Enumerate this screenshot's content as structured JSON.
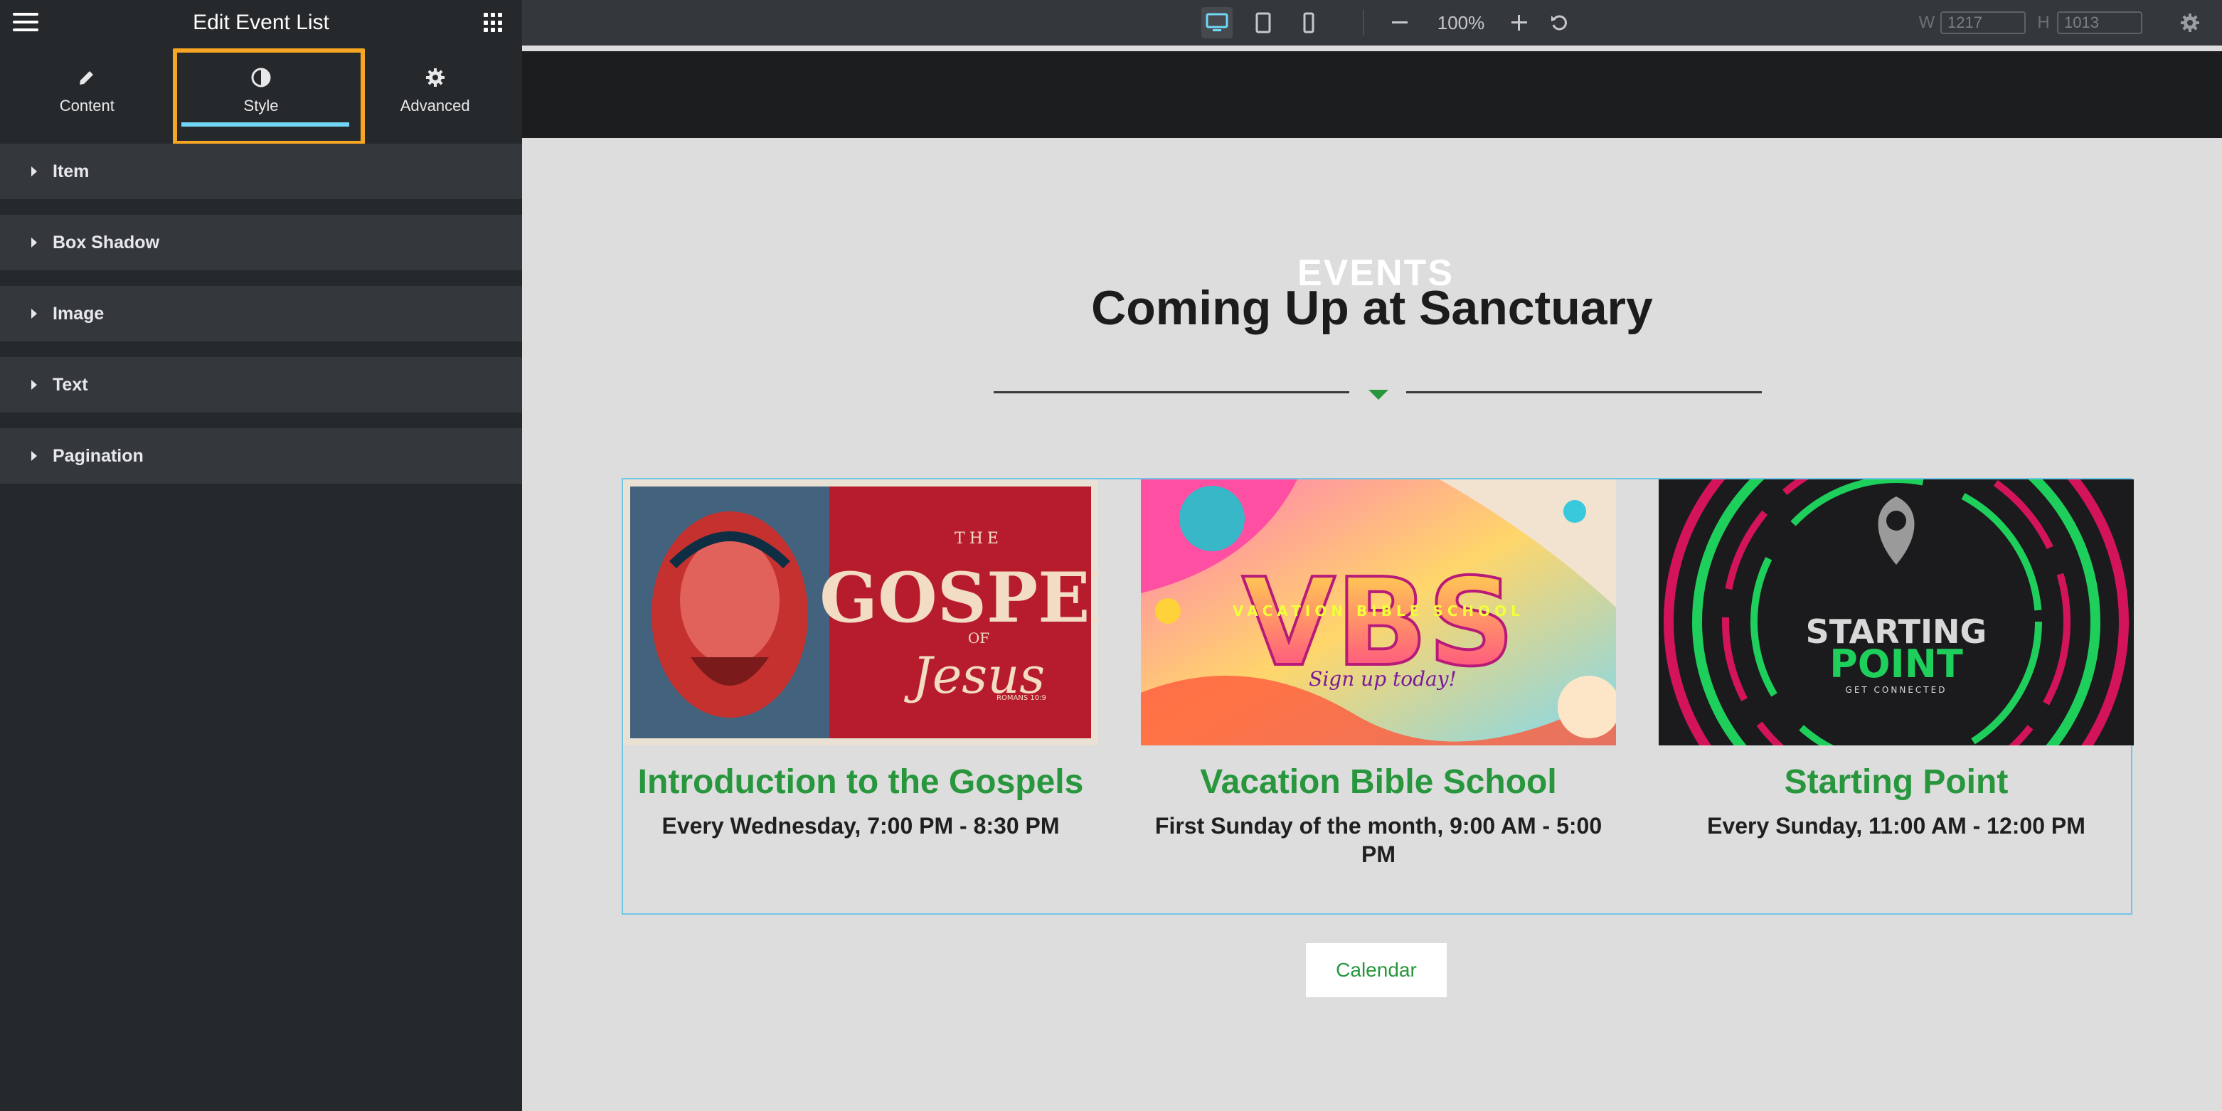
{
  "panel": {
    "title": "Edit Event List",
    "tabs": [
      {
        "label": "Content",
        "icon": "pencil-icon"
      },
      {
        "label": "Style",
        "icon": "half-circle-icon",
        "active": true
      },
      {
        "label": "Advanced",
        "icon": "gear-icon"
      }
    ],
    "sections": [
      {
        "label": "Item"
      },
      {
        "label": "Box Shadow"
      },
      {
        "label": "Image"
      },
      {
        "label": "Text"
      },
      {
        "label": "Pagination"
      }
    ]
  },
  "topbar": {
    "zoom": "100%",
    "width_label": "W",
    "width_value": "1217",
    "height_label": "H",
    "height_value": "1013",
    "devices": [
      "desktop-icon",
      "tablet-icon",
      "mobile-icon"
    ]
  },
  "page": {
    "eyebrow": "EVENTS",
    "heading": "Coming Up at Sanctuary",
    "events": [
      {
        "title": "Introduction to the Gospels",
        "time": "Every Wednesday, 7:00 PM - 8:30 PM",
        "image_text": {
          "line1": "THE",
          "line2": "GOSPEL",
          "line3": "OF",
          "line4": "Jesus",
          "line5": "ROMANS 10:9"
        }
      },
      {
        "title": "Vacation Bible School",
        "time": "First Sunday of the month, 9:00 AM - 5:00 PM",
        "image_text": {
          "line1": "VBS",
          "line2": "VACATION BIBLE SCHOOL",
          "line3": "Sign up today!"
        }
      },
      {
        "title": "Starting Point",
        "time": "Every Sunday, 11:00 AM - 12:00 PM",
        "image_text": {
          "line1": "STARTING",
          "line2": "POINT",
          "line3": "GET CONNECTED"
        }
      }
    ],
    "button": "Calendar"
  },
  "colors": {
    "accent_green": "#27963c",
    "highlight_orange": "#f6a623",
    "tab_underline": "#71d7f7",
    "panel_bg": "#26292c"
  }
}
